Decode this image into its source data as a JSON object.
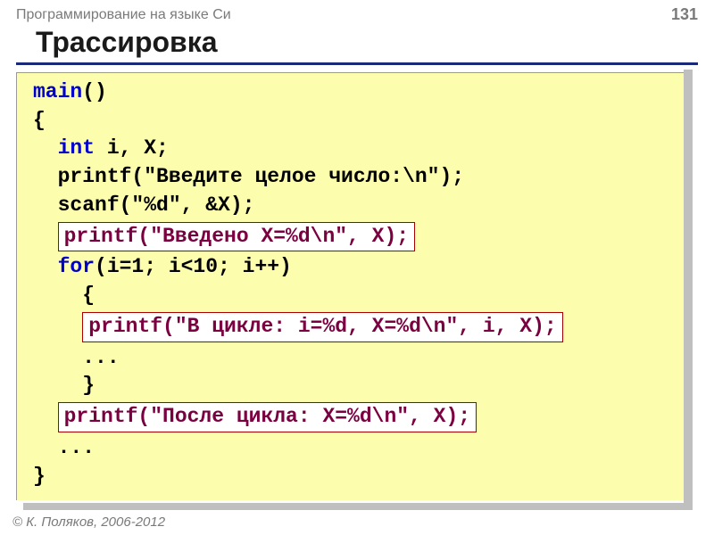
{
  "header": {
    "subject": "Программирование на языке Си",
    "page_number": "131"
  },
  "title": "Трассировка",
  "code": {
    "l1a": "main",
    "l1b": "()",
    "l2": "{",
    "l3a": "  int",
    "l3b": " i, X;",
    "l4": "  printf(\"Введите целое число:\\n\");",
    "l5": "  scanf(\"%d\", &X);",
    "hl1": "printf(\"Введено X=%d\\n\", X);",
    "l6a": "  for",
    "l6b": "(i=1; i<10; i++)",
    "l7": "    {",
    "hl2": "printf(\"В цикле: i=%d, X=%d\\n\", i, X);",
    "l8": "    ...",
    "l9": "    }",
    "hl3": "printf(\"После цикла: X=%d\\n\", X);",
    "l10": "  ...",
    "l11": "}"
  },
  "footer": "© К. Поляков, 2006-2012"
}
